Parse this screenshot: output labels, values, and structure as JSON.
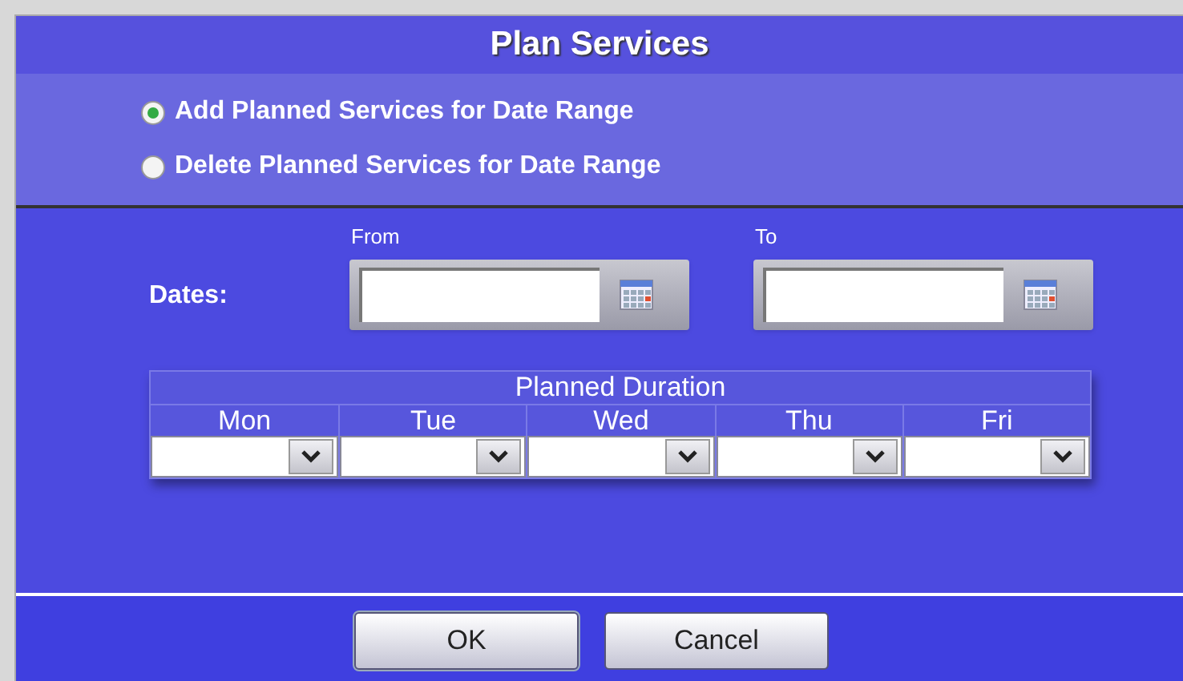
{
  "title": "Plan Services",
  "options": [
    {
      "label": "Add Planned Services for Date Range",
      "selected": true
    },
    {
      "label": "Delete Planned Services for Date Range",
      "selected": false
    }
  ],
  "dates": {
    "label": "Dates:",
    "fields": [
      {
        "caption": "From"
      },
      {
        "caption": "To"
      }
    ]
  },
  "duration": {
    "title": "Planned Duration",
    "days": [
      "Mon",
      "Tue",
      "Wed",
      "Thu",
      "Fri"
    ]
  },
  "buttons": [
    "OK",
    "Cancel"
  ]
}
